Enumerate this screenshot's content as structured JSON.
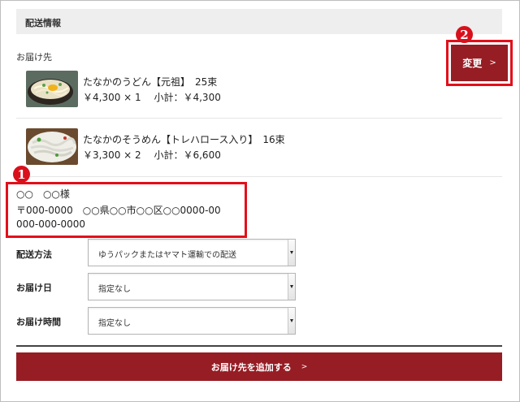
{
  "section": {
    "title": "配送情報"
  },
  "recipient_label": "お届け先",
  "items": [
    {
      "name": "たなかのうどん【元祖】　25束",
      "price": "￥4,300 × 1　 小計：￥4,300",
      "image": "udon-bowl-photo"
    },
    {
      "name": "たなかのそうめん【トレハロース入り】　16束",
      "price": "￥3,300 × 2　 小計：￥6,600",
      "image": "somen-plate-photo"
    }
  ],
  "change_button": {
    "label": "変更",
    "chevron": ">"
  },
  "callouts": {
    "address": "1",
    "change": "2"
  },
  "address": {
    "name": "○○　○○様",
    "postal": "〒000-0000　○○県○○市○○区○○0000-00",
    "phone": "000-000-0000"
  },
  "form": {
    "method": {
      "label": "配送方法",
      "value": "ゆうパックまたはヤマト運輸での配送"
    },
    "date": {
      "label": "お届け日",
      "value": "指定なし"
    },
    "time": {
      "label": "お届け時間",
      "value": "指定なし"
    }
  },
  "add_button": {
    "label": "お届け先を追加する",
    "chevron": ">"
  },
  "colors": {
    "accent": "#961d24",
    "highlight": "#e30f1a",
    "badge": "#d9101b"
  }
}
